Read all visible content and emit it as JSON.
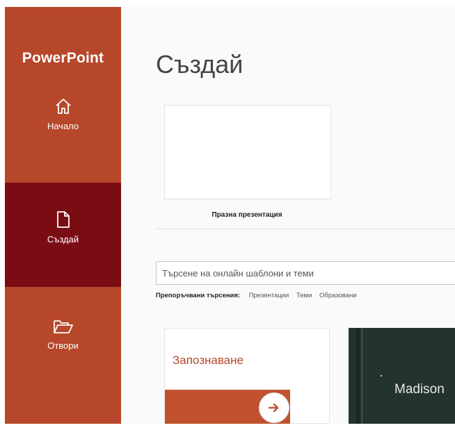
{
  "app": {
    "title": "PowerPoint"
  },
  "sidebar": {
    "items": [
      {
        "label": "Начало",
        "icon": "home-icon"
      },
      {
        "label": "Създай",
        "icon": "new-document-icon",
        "selected": true
      },
      {
        "label": "Отвори",
        "icon": "open-folder-icon"
      }
    ]
  },
  "main": {
    "title": "Създай",
    "blank_presentation_label": "Празна презентация",
    "search": {
      "placeholder": "Търсене на онлайн шаблони и теми"
    },
    "suggested": {
      "label": "Препоръчвани търсения:",
      "links": [
        "Презентации",
        "Теми",
        "Образовани"
      ]
    },
    "templates": [
      {
        "title": "Запознаване",
        "icon": "arrow-right-icon"
      },
      {
        "title": "Madison"
      }
    ]
  },
  "colors": {
    "brand": "#b7472a",
    "selected": "#7a0c14",
    "template_dark": "#253330"
  }
}
